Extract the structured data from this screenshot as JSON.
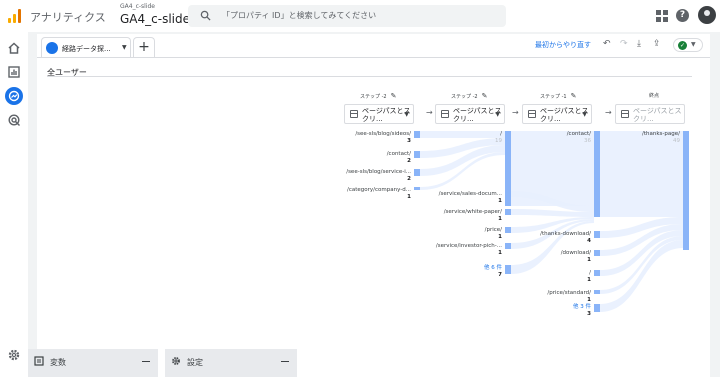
{
  "app": {
    "title": "アナリティクス",
    "property_small": "GA4_c-slide",
    "property_name": "GA4_c-slide"
  },
  "search": {
    "placeholder": "「プロパティ ID」と検索してみてください"
  },
  "header_icons": [
    "apps-grid-icon",
    "help-icon",
    "account-avatar"
  ],
  "nav": [
    "home-icon",
    "reports-icon",
    "explore-icon",
    "advertising-icon",
    "admin-gear-icon"
  ],
  "tabs": {
    "active_label": "経路データ探...",
    "add_label": "+"
  },
  "toolbar": {
    "undo_link": "最初からやり直す",
    "icons": [
      "undo-icon",
      "redo-icon",
      "download-icon",
      "share-icon",
      "add-user-icon",
      "status-check-icon"
    ]
  },
  "segment": {
    "label": "全ユーザー"
  },
  "steps": [
    {
      "header": "ステップ -2",
      "dimension": "ページパスとスクリ...",
      "placeholder": false
    },
    {
      "header": "ステップ -2",
      "dimension": "ページパスとスクリ...",
      "placeholder": false
    },
    {
      "header": "ステップ -1",
      "dimension": "ページパスとスクリ...",
      "placeholder": false
    },
    {
      "header": "終点",
      "dimension": "ページパスとスクリ...",
      "placeholder": true
    }
  ],
  "columns": [
    {
      "nodes": [
        {
          "label": "/see-sls/blog/sideos/",
          "value": "3"
        },
        {
          "label": "/contact/",
          "value": "2"
        },
        {
          "label": "/see-sls/blog/service-i...",
          "value": "2"
        },
        {
          "label": "/category/company-d...",
          "value": "1"
        }
      ]
    },
    {
      "nodes": [
        {
          "label": "/",
          "value": "19"
        },
        {
          "label": "/service/sales-docum...",
          "value": "1"
        },
        {
          "label": "/service/white-paper/",
          "value": "1"
        },
        {
          "label": "/price/",
          "value": "1"
        },
        {
          "label": "/service/investor-pich-...",
          "value": "1"
        },
        {
          "label": "他 6 件",
          "value": "7",
          "more": true
        }
      ]
    },
    {
      "nodes": [
        {
          "label": "/contact/",
          "value": "36"
        },
        {
          "label": "/thanks-download/",
          "value": "4"
        },
        {
          "label": "/download/",
          "value": "1"
        },
        {
          "label": "/",
          "value": "1"
        },
        {
          "label": "/price/standard/",
          "value": "1"
        },
        {
          "label": "他 3 件",
          "value": "3",
          "more": true
        }
      ]
    },
    {
      "nodes": [
        {
          "label": "/thanks-page/",
          "value": "49"
        }
      ]
    }
  ],
  "bottom": {
    "variables": "変数",
    "settings": "設定"
  },
  "colors": {
    "accent": "#1a73e8",
    "node": "#8ab4f8",
    "flow": "#e8f0fe"
  }
}
